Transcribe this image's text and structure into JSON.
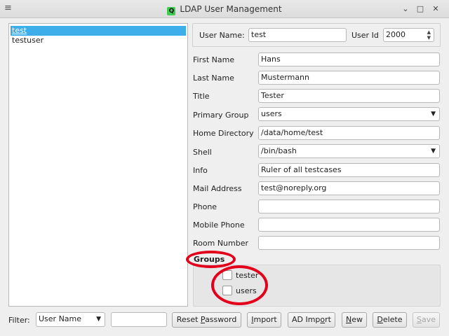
{
  "window": {
    "title": "LDAP User Management",
    "app_icon": "Q"
  },
  "users": [
    "test",
    "testuser"
  ],
  "form": {
    "user_name_label": "User Name:",
    "user_name_value": "test",
    "user_id_label": "User Id",
    "user_id_value": "2000",
    "first_name_label": "First Name",
    "first_name_value": "Hans",
    "last_name_label": "Last Name",
    "last_name_value": "Mustermann",
    "title_label": "Title",
    "title_value": "Tester",
    "primary_group_label": "Primary Group",
    "primary_group_value": "users",
    "home_dir_label": "Home Directory",
    "home_dir_value": "/data/home/test",
    "shell_label": "Shell",
    "shell_value": "/bin/bash",
    "info_label": "Info",
    "info_value": "Ruler of all testcases",
    "mail_label": "Mail Address",
    "mail_value": "test@noreply.org",
    "phone_label": "Phone",
    "phone_value": "",
    "mobile_label": "Mobile Phone",
    "mobile_value": "",
    "room_label": "Room Number",
    "room_value": ""
  },
  "groups": {
    "label": "Groups",
    "items": [
      "tester",
      "users"
    ]
  },
  "toolbar": {
    "filter_label": "Filter:",
    "filter_field_value": "User Name",
    "filter_text": "",
    "reset_prefix": "Reset ",
    "reset_accel": "P",
    "reset_suffix": "assword",
    "import_accel": "I",
    "import_suffix": "mport",
    "ad_prefix": "AD Imp",
    "ad_accel": "o",
    "ad_suffix": "rt",
    "new_accel": "N",
    "new_suffix": "ew",
    "delete_accel": "D",
    "delete_suffix": "elete",
    "save_accel": "S",
    "save_suffix": "ave"
  },
  "colors": {
    "selection": "#3daee9",
    "annotation": "#e3001b"
  }
}
